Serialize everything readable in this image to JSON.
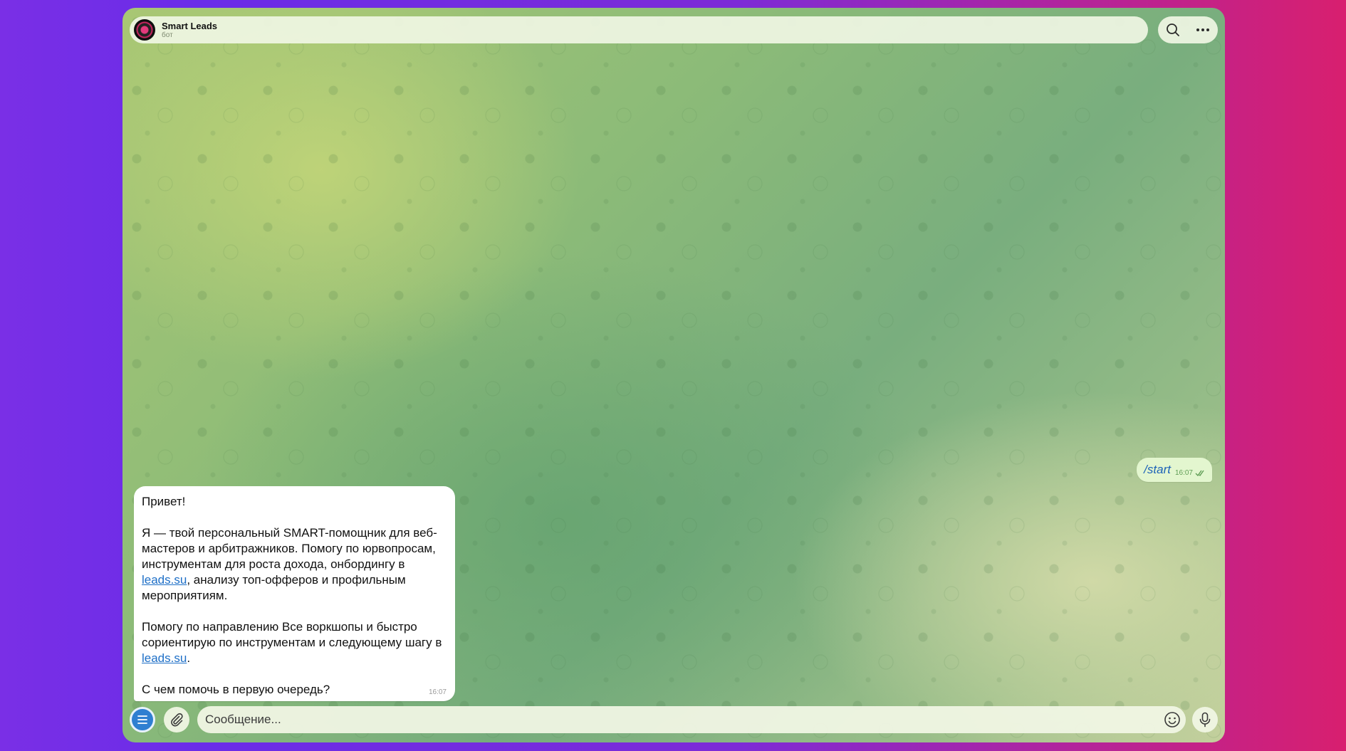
{
  "header": {
    "title": "Smart Leads",
    "subtitle": "бот",
    "icons": [
      "search-icon",
      "more-icon"
    ]
  },
  "messages": {
    "outgoing": {
      "text": "/start",
      "time": "16:07",
      "status_icon": "double-check-icon"
    },
    "incoming": {
      "greeting": "Привет!",
      "p1_before": "Я — твой персональный SMART-помощник для веб-мастеров и арбитражников. Помогу по юрвопросам, инструментам для роста дохода, онбордингу в ",
      "p1_link": "leads.su",
      "p1_after": ", анализу топ-офферов и профильным мероприятиям.",
      "p2_before": "Помогу по направлению Все воркшопы и быстро сориентирую по инструментам и следующему шагу в ",
      "p2_link": "leads.su",
      "p2_after": ".",
      "question": "С чем помочь в первую очередь?",
      "time": "16:07"
    }
  },
  "composer": {
    "placeholder": "Сообщение...",
    "icons": [
      "menu-icon",
      "paperclip-icon",
      "emoji-icon",
      "microphone-icon"
    ]
  },
  "colors": {
    "accent": "#2f7fd1",
    "link": "#1e6fc7",
    "outgoing_bubble": "#e3f6cf"
  }
}
